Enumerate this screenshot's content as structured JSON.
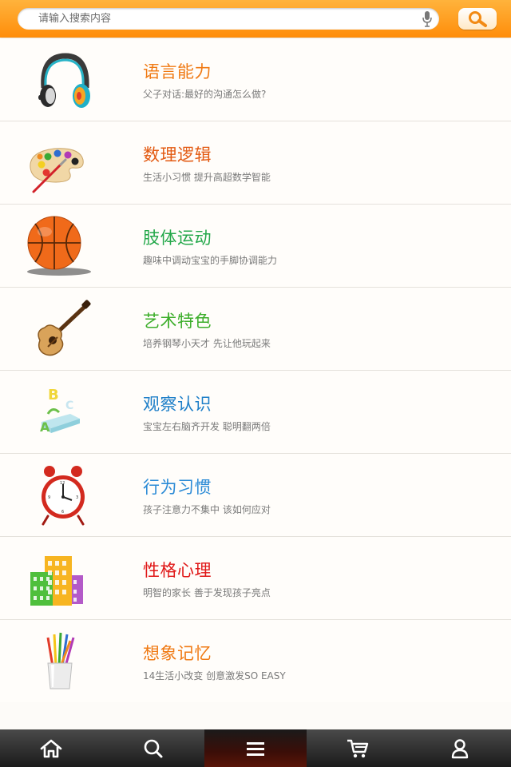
{
  "search": {
    "placeholder": "请输入搜索内容",
    "mic_icon": "microphone-icon",
    "button_icon": "search-icon"
  },
  "categories": [
    {
      "title": "语言能力",
      "desc": "父子对话:最好的沟通怎么做?",
      "color": "#f07a14",
      "icon": "headphones-icon"
    },
    {
      "title": "数理逻辑",
      "desc": "生活小习惯 提升高超数学智能",
      "color": "#e35a12",
      "icon": "paint-palette-icon"
    },
    {
      "title": "肢体运动",
      "desc": "趣味中调动宝宝的手脚协调能力",
      "color": "#24a84a",
      "icon": "basketball-icon"
    },
    {
      "title": "艺术特色",
      "desc": "培养钢琴小天才 先让他玩起来",
      "color": "#3cae2a",
      "icon": "guitar-icon"
    },
    {
      "title": "观察认识",
      "desc": "宝宝左右脑齐开发 聪明翻两倍",
      "color": "#1e7fc8",
      "icon": "abc-blocks-icon"
    },
    {
      "title": "行为习惯",
      "desc": "孩子注意力不集中 该如何应对",
      "color": "#2a8ad6",
      "icon": "alarm-clock-icon"
    },
    {
      "title": "性格心理",
      "desc": "明智的家长 善于发现孩子亮点",
      "color": "#e01818",
      "icon": "buildings-icon"
    },
    {
      "title": "想象记忆",
      "desc": "14生活小改变 创意激发SO EASY",
      "color": "#f07a14",
      "icon": "pencil-cup-icon"
    }
  ],
  "tabbar": {
    "items": [
      {
        "icon": "home-icon"
      },
      {
        "icon": "search-icon"
      },
      {
        "icon": "menu-icon",
        "active": true
      },
      {
        "icon": "cart-icon"
      },
      {
        "icon": "user-icon"
      }
    ]
  }
}
